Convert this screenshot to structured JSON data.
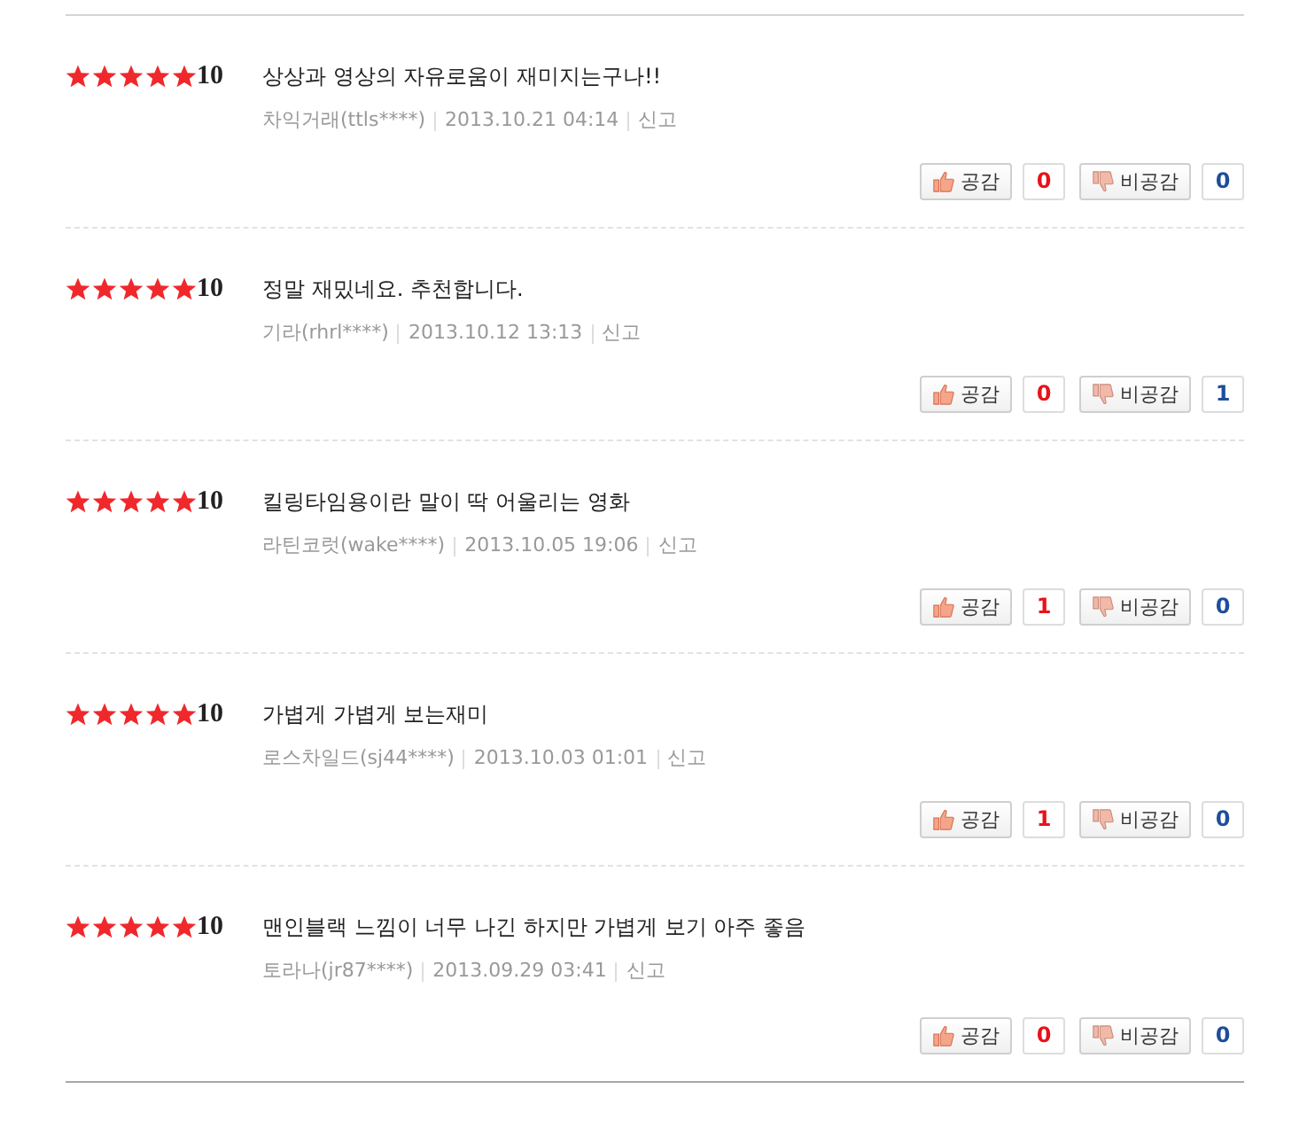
{
  "reviews": [
    {
      "stars": 5,
      "score": "10",
      "comment": "상상과 영상의 자유로움이 재미지는구나!!",
      "author": "차익거래(ttls****)",
      "date": "2013.10.21 04:14",
      "report": "신고",
      "like_label": "공감",
      "like_count": "0",
      "dislike_label": "비공감",
      "dislike_count": "0"
    },
    {
      "stars": 5,
      "score": "10",
      "comment": "정말 재밌네요. 추천합니다.",
      "author": "기라(rhrl****)",
      "date": "2013.10.12 13:13",
      "report": "신고",
      "like_label": "공감",
      "like_count": "0",
      "dislike_label": "비공감",
      "dislike_count": "1"
    },
    {
      "stars": 5,
      "score": "10",
      "comment": "킬링타임용이란 말이 딱 어울리는 영화",
      "author": "라틴코럿(wake****)",
      "date": "2013.10.05 19:06",
      "report": "신고",
      "like_label": "공감",
      "like_count": "1",
      "dislike_label": "비공감",
      "dislike_count": "0"
    },
    {
      "stars": 5,
      "score": "10",
      "comment": "가볍게 가볍게 보는재미",
      "author": "로스차일드(sj44****)",
      "date": "2013.10.03 01:01",
      "report": "신고",
      "like_label": "공감",
      "like_count": "1",
      "dislike_label": "비공감",
      "dislike_count": "0"
    },
    {
      "stars": 5,
      "score": "10",
      "comment": "맨인블랙 느낌이 너무 나긴 하지만 가볍게 보기 아주 좋음",
      "author": "토라나(jr87****)",
      "date": "2013.09.29 03:41",
      "report": "신고",
      "like_label": "공감",
      "like_count": "0",
      "dislike_label": "비공감",
      "dislike_count": "0"
    }
  ]
}
